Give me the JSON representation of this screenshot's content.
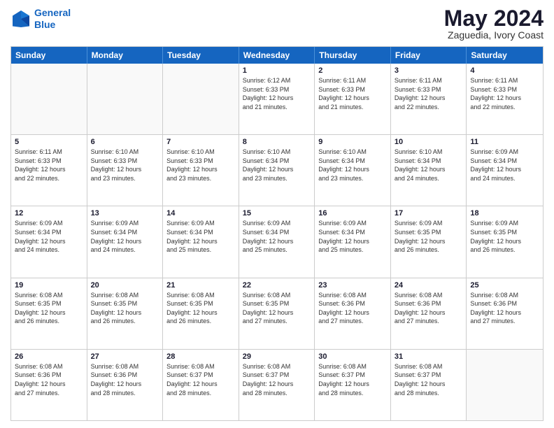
{
  "logo": {
    "line1": "General",
    "line2": "Blue"
  },
  "title": "May 2024",
  "location": "Zaguedia, Ivory Coast",
  "days_header": [
    "Sunday",
    "Monday",
    "Tuesday",
    "Wednesday",
    "Thursday",
    "Friday",
    "Saturday"
  ],
  "weeks": [
    [
      {
        "day": "",
        "info": "",
        "empty": true
      },
      {
        "day": "",
        "info": "",
        "empty": true
      },
      {
        "day": "",
        "info": "",
        "empty": true
      },
      {
        "day": "1",
        "info": "Sunrise: 6:12 AM\nSunset: 6:33 PM\nDaylight: 12 hours\nand 21 minutes.",
        "empty": false
      },
      {
        "day": "2",
        "info": "Sunrise: 6:11 AM\nSunset: 6:33 PM\nDaylight: 12 hours\nand 21 minutes.",
        "empty": false
      },
      {
        "day": "3",
        "info": "Sunrise: 6:11 AM\nSunset: 6:33 PM\nDaylight: 12 hours\nand 22 minutes.",
        "empty": false
      },
      {
        "day": "4",
        "info": "Sunrise: 6:11 AM\nSunset: 6:33 PM\nDaylight: 12 hours\nand 22 minutes.",
        "empty": false
      }
    ],
    [
      {
        "day": "5",
        "info": "Sunrise: 6:11 AM\nSunset: 6:33 PM\nDaylight: 12 hours\nand 22 minutes.",
        "empty": false
      },
      {
        "day": "6",
        "info": "Sunrise: 6:10 AM\nSunset: 6:33 PM\nDaylight: 12 hours\nand 23 minutes.",
        "empty": false
      },
      {
        "day": "7",
        "info": "Sunrise: 6:10 AM\nSunset: 6:33 PM\nDaylight: 12 hours\nand 23 minutes.",
        "empty": false
      },
      {
        "day": "8",
        "info": "Sunrise: 6:10 AM\nSunset: 6:34 PM\nDaylight: 12 hours\nand 23 minutes.",
        "empty": false
      },
      {
        "day": "9",
        "info": "Sunrise: 6:10 AM\nSunset: 6:34 PM\nDaylight: 12 hours\nand 23 minutes.",
        "empty": false
      },
      {
        "day": "10",
        "info": "Sunrise: 6:10 AM\nSunset: 6:34 PM\nDaylight: 12 hours\nand 24 minutes.",
        "empty": false
      },
      {
        "day": "11",
        "info": "Sunrise: 6:09 AM\nSunset: 6:34 PM\nDaylight: 12 hours\nand 24 minutes.",
        "empty": false
      }
    ],
    [
      {
        "day": "12",
        "info": "Sunrise: 6:09 AM\nSunset: 6:34 PM\nDaylight: 12 hours\nand 24 minutes.",
        "empty": false
      },
      {
        "day": "13",
        "info": "Sunrise: 6:09 AM\nSunset: 6:34 PM\nDaylight: 12 hours\nand 24 minutes.",
        "empty": false
      },
      {
        "day": "14",
        "info": "Sunrise: 6:09 AM\nSunset: 6:34 PM\nDaylight: 12 hours\nand 25 minutes.",
        "empty": false
      },
      {
        "day": "15",
        "info": "Sunrise: 6:09 AM\nSunset: 6:34 PM\nDaylight: 12 hours\nand 25 minutes.",
        "empty": false
      },
      {
        "day": "16",
        "info": "Sunrise: 6:09 AM\nSunset: 6:34 PM\nDaylight: 12 hours\nand 25 minutes.",
        "empty": false
      },
      {
        "day": "17",
        "info": "Sunrise: 6:09 AM\nSunset: 6:35 PM\nDaylight: 12 hours\nand 26 minutes.",
        "empty": false
      },
      {
        "day": "18",
        "info": "Sunrise: 6:09 AM\nSunset: 6:35 PM\nDaylight: 12 hours\nand 26 minutes.",
        "empty": false
      }
    ],
    [
      {
        "day": "19",
        "info": "Sunrise: 6:08 AM\nSunset: 6:35 PM\nDaylight: 12 hours\nand 26 minutes.",
        "empty": false
      },
      {
        "day": "20",
        "info": "Sunrise: 6:08 AM\nSunset: 6:35 PM\nDaylight: 12 hours\nand 26 minutes.",
        "empty": false
      },
      {
        "day": "21",
        "info": "Sunrise: 6:08 AM\nSunset: 6:35 PM\nDaylight: 12 hours\nand 26 minutes.",
        "empty": false
      },
      {
        "day": "22",
        "info": "Sunrise: 6:08 AM\nSunset: 6:35 PM\nDaylight: 12 hours\nand 27 minutes.",
        "empty": false
      },
      {
        "day": "23",
        "info": "Sunrise: 6:08 AM\nSunset: 6:36 PM\nDaylight: 12 hours\nand 27 minutes.",
        "empty": false
      },
      {
        "day": "24",
        "info": "Sunrise: 6:08 AM\nSunset: 6:36 PM\nDaylight: 12 hours\nand 27 minutes.",
        "empty": false
      },
      {
        "day": "25",
        "info": "Sunrise: 6:08 AM\nSunset: 6:36 PM\nDaylight: 12 hours\nand 27 minutes.",
        "empty": false
      }
    ],
    [
      {
        "day": "26",
        "info": "Sunrise: 6:08 AM\nSunset: 6:36 PM\nDaylight: 12 hours\nand 27 minutes.",
        "empty": false
      },
      {
        "day": "27",
        "info": "Sunrise: 6:08 AM\nSunset: 6:36 PM\nDaylight: 12 hours\nand 28 minutes.",
        "empty": false
      },
      {
        "day": "28",
        "info": "Sunrise: 6:08 AM\nSunset: 6:37 PM\nDaylight: 12 hours\nand 28 minutes.",
        "empty": false
      },
      {
        "day": "29",
        "info": "Sunrise: 6:08 AM\nSunset: 6:37 PM\nDaylight: 12 hours\nand 28 minutes.",
        "empty": false
      },
      {
        "day": "30",
        "info": "Sunrise: 6:08 AM\nSunset: 6:37 PM\nDaylight: 12 hours\nand 28 minutes.",
        "empty": false
      },
      {
        "day": "31",
        "info": "Sunrise: 6:08 AM\nSunset: 6:37 PM\nDaylight: 12 hours\nand 28 minutes.",
        "empty": false
      },
      {
        "day": "",
        "info": "",
        "empty": true
      }
    ]
  ]
}
